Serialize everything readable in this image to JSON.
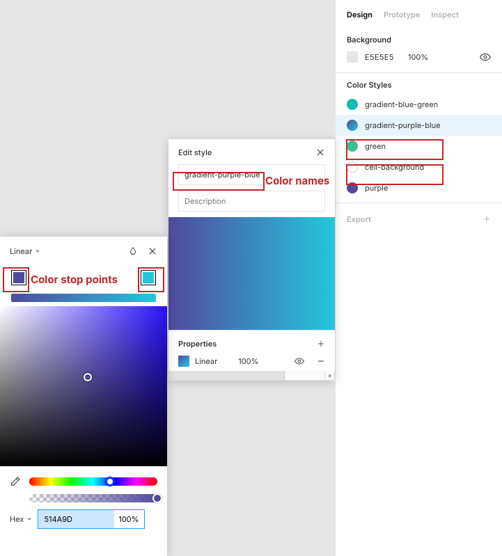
{
  "inspector": {
    "tabs": {
      "design": "Design",
      "prototype": "Prototype",
      "inspect": "Inspect"
    },
    "background": {
      "title": "Background",
      "hex": "E5E5E5",
      "opacity": "100%"
    },
    "color_styles": {
      "title": "Color Styles",
      "items": [
        {
          "name": "gradient-blue-green"
        },
        {
          "name": "gradient-purple-blue"
        },
        {
          "name": "green"
        },
        {
          "name": "cell-background"
        },
        {
          "name": "purple"
        }
      ]
    },
    "export": {
      "title": "Export"
    }
  },
  "edit_style": {
    "title": "Edit style",
    "name_value": "gradient-purple-blue",
    "description_placeholder": "Description",
    "properties": {
      "title": "Properties",
      "type": "Linear",
      "opacity": "100%"
    }
  },
  "picker": {
    "type_label": "Linear",
    "stops": [
      {
        "index": 0,
        "color": "#514A9D"
      },
      {
        "index": 1,
        "color": "#24C6DC"
      }
    ],
    "hex_mode_label": "Hex",
    "hex_value": "514A9D",
    "opacity_value": "100%"
  },
  "annotations": {
    "color_names": "Color names",
    "color_stops": "Color stop points"
  }
}
